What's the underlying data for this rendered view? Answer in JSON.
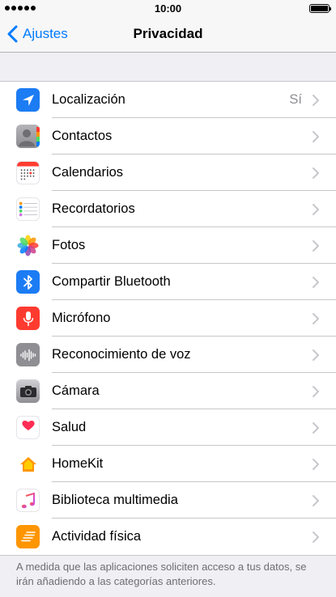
{
  "status_bar": {
    "time": "10:00"
  },
  "nav": {
    "back_label": "Ajustes",
    "title": "Privacidad"
  },
  "rows": [
    {
      "label": "Localización",
      "value": "Sí",
      "icon": "location-arrow-icon",
      "icon_color": "#1c7cf4"
    },
    {
      "label": "Contactos",
      "icon": "contacts-icon",
      "icon_color": "#9a9a9e"
    },
    {
      "label": "Calendarios",
      "icon": "calendar-icon",
      "icon_color": "#ff3b30"
    },
    {
      "label": "Recordatorios",
      "icon": "reminders-icon",
      "icon_color": "#ffffff"
    },
    {
      "label": "Fotos",
      "icon": "photos-icon",
      "icon_color": "#ffffff"
    },
    {
      "label": "Compartir Bluetooth",
      "icon": "bluetooth-icon",
      "icon_color": "#1c7cf4"
    },
    {
      "label": "Micrófono",
      "icon": "microphone-icon",
      "icon_color": "#ff3b30"
    },
    {
      "label": "Reconocimiento de voz",
      "icon": "waveform-icon",
      "icon_color": "#8e8e93"
    },
    {
      "label": "Cámara",
      "icon": "camera-icon",
      "icon_color": "#8e8e93"
    },
    {
      "label": "Salud",
      "icon": "heart-icon",
      "icon_color": "#ffffff"
    },
    {
      "label": "HomeKit",
      "icon": "home-icon",
      "icon_color": "#ffffff"
    },
    {
      "label": "Biblioteca multimedia",
      "icon": "music-note-icon",
      "icon_color": "#ffffff"
    },
    {
      "label": "Actividad física",
      "icon": "motion-icon",
      "icon_color": "#ff9500"
    }
  ],
  "footer": {
    "text": "A medida que las aplicaciones soliciten acceso a tus datos, se irán añadiendo a las categorías anteriores."
  }
}
